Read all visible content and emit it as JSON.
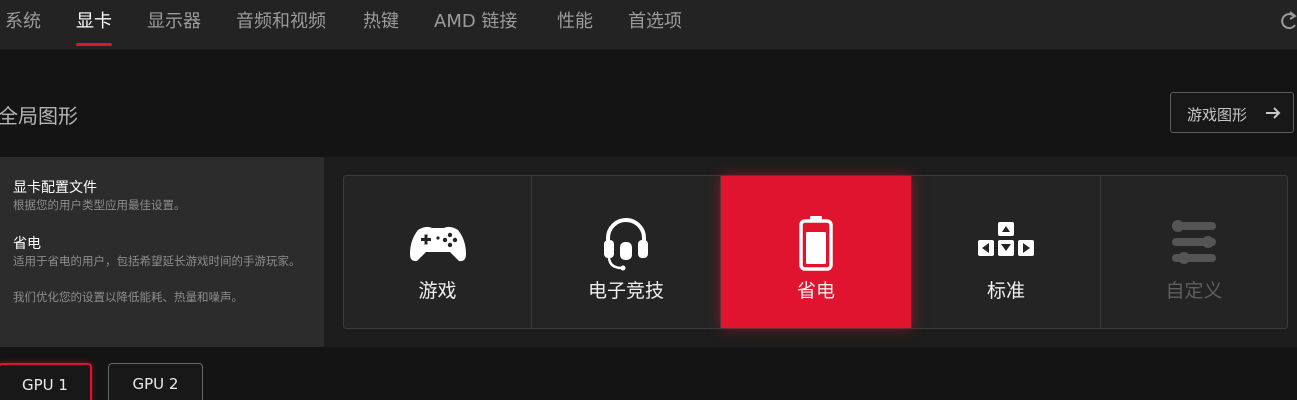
{
  "nav": {
    "tabs": [
      {
        "label": "系统"
      },
      {
        "label": "显卡",
        "active": true
      },
      {
        "label": "显示器"
      },
      {
        "label": "音频和视频"
      },
      {
        "label": "热键"
      },
      {
        "label": "AMD 链接"
      },
      {
        "label": "性能"
      },
      {
        "label": "首选项"
      }
    ],
    "refresh_icon": "refresh-icon"
  },
  "section": {
    "title": "全局图形",
    "game_graphics_button": "游戏图形",
    "arrow_icon": "arrow-right-icon"
  },
  "info": {
    "profile_heading": "显卡配置文件",
    "profile_desc": "根据您的用户类型应用最佳设置。",
    "selected_heading": "省电",
    "selected_desc_1": "适用于省电的用户，包括希望延长游戏时间的手游玩家。",
    "selected_desc_2": "我们优化您的设置以降低能耗、热量和噪声。"
  },
  "profiles": [
    {
      "label": "游戏",
      "icon": "gamepad-icon"
    },
    {
      "label": "电子竞技",
      "icon": "headset-icon"
    },
    {
      "label": "省电",
      "icon": "battery-icon",
      "selected": true
    },
    {
      "label": "标准",
      "icon": "keyboard-arrows-icon"
    },
    {
      "label": "自定义",
      "icon": "sliders-icon",
      "disabled": true
    }
  ],
  "gpus": [
    {
      "label": "GPU 1",
      "active": true
    },
    {
      "label": "GPU 2"
    }
  ],
  "colors": {
    "accent": "#e0142e",
    "background": "#141414",
    "nav_bg": "#232323",
    "panel_bg": "#2c2c2c"
  }
}
